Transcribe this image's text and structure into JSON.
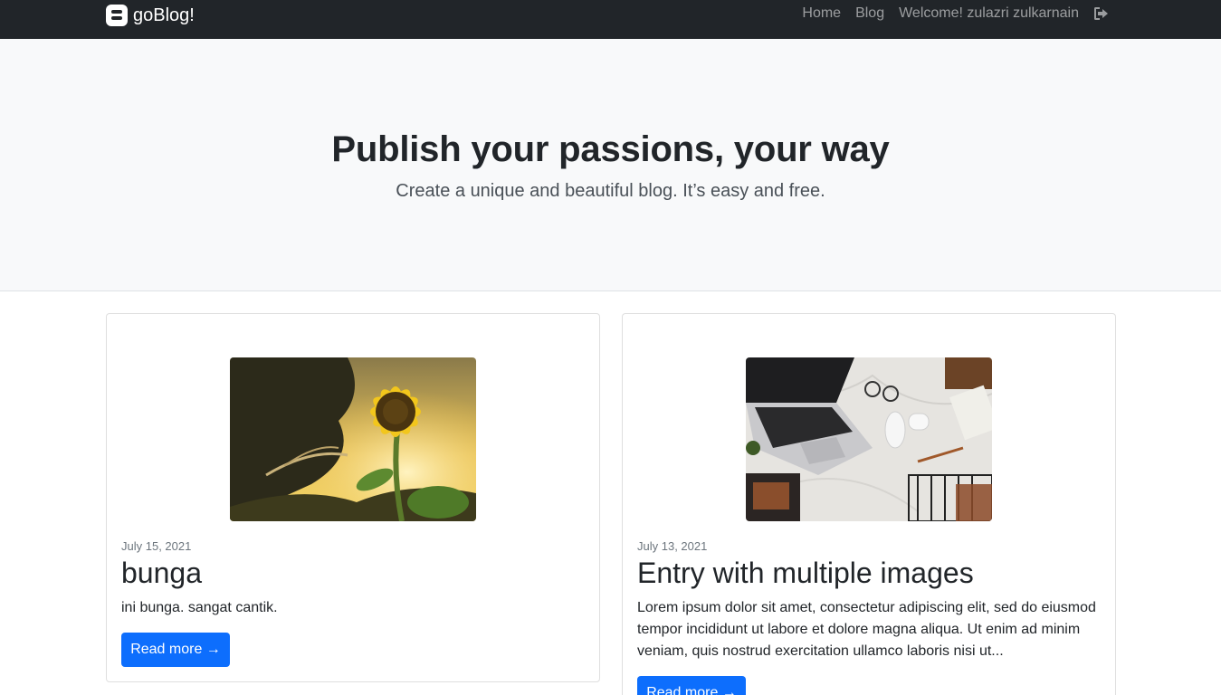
{
  "navbar": {
    "brand": "goBlog!",
    "links": [
      "Home",
      "Blog",
      "Welcome! zulazri zulkarnain"
    ],
    "logout_icon": "sign-out-icon"
  },
  "hero": {
    "title": "Publish your passions, your way",
    "subtitle": "Create a unique and beautiful blog. It’s easy and free."
  },
  "posts": [
    {
      "image": "sunflower-photo",
      "date": "July 15, 2021",
      "title": "bunga",
      "excerpt": "ini bunga. sangat cantik.",
      "button": "Read more →"
    },
    {
      "image": "laptop-desk-photo",
      "date": "July 13, 2021",
      "title": "Entry with multiple images",
      "excerpt": "Lorem ipsum dolor sit amet, consectetur adipiscing elit, sed do eiusmod tempor incididunt ut labore et dolore magna aliqua. Ut enim ad minim veniam, quis nostrud exercitation ullamco laboris nisi ut...",
      "button": "Read more →"
    }
  ],
  "colors": {
    "navbar_bg": "#212529",
    "hero_bg": "#f8f9fa",
    "primary": "#0d6efd"
  }
}
